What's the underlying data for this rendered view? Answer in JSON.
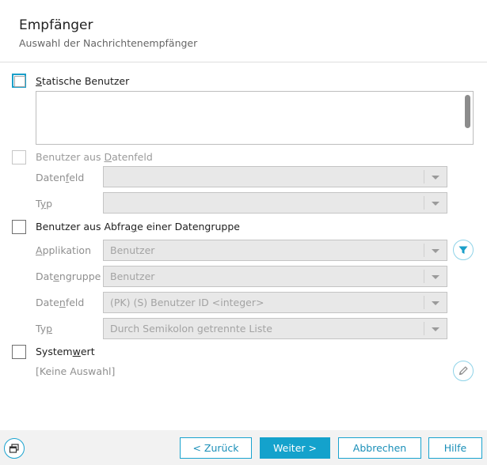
{
  "header": {
    "title": "Empfänger",
    "subtitle": "Auswahl der Nachrichtenempfänger"
  },
  "static_users": {
    "label_pre": "",
    "label_key": "S",
    "label_post": "tatische Benutzer",
    "checked": false
  },
  "field_users": {
    "label_pre": "Benutzer aus ",
    "label_key": "D",
    "label_post": "atenfeld",
    "checked": false,
    "datenfeld": {
      "label_pre": "Daten",
      "label_key": "f",
      "label_post": "eld",
      "value": ""
    },
    "typ": {
      "label_pre": "T",
      "label_key": "y",
      "label_post": "p",
      "value": ""
    }
  },
  "query_users": {
    "label_pre": "Benutzer aus Abfra",
    "label_key": "g",
    "label_post": "e einer Datengruppe",
    "checked": false,
    "applikation": {
      "label_pre": "",
      "label_key": "A",
      "label_post": "pplikation",
      "value": "Benutzer"
    },
    "datengruppe": {
      "label_pre": "Dat",
      "label_key": "e",
      "label_post": "ngruppe",
      "value": "Benutzer"
    },
    "datenfeld": {
      "label_pre": "Date",
      "label_key": "n",
      "label_post": "feld",
      "value": "(PK) (S) Benutzer ID <integer>"
    },
    "typ": {
      "label_pre": "Ty",
      "label_key": "p",
      "label_post": "",
      "value": "Durch Semikolon getrennte Liste"
    }
  },
  "system_value": {
    "label_pre": "System",
    "label_key": "w",
    "label_post": "ert",
    "checked": false,
    "value": "[Keine Auswahl]"
  },
  "icons": {
    "filter": "filter-icon",
    "edit": "pencil-icon",
    "window": "window-icon"
  },
  "footer": {
    "back": "< Zurück",
    "next": "Weiter >",
    "cancel": "Abbrechen",
    "help": "Hilfe"
  },
  "colors": {
    "accent": "#14a2cc",
    "focus_border": "#1a9fc9",
    "disabled_field": "#e8e8e8"
  }
}
